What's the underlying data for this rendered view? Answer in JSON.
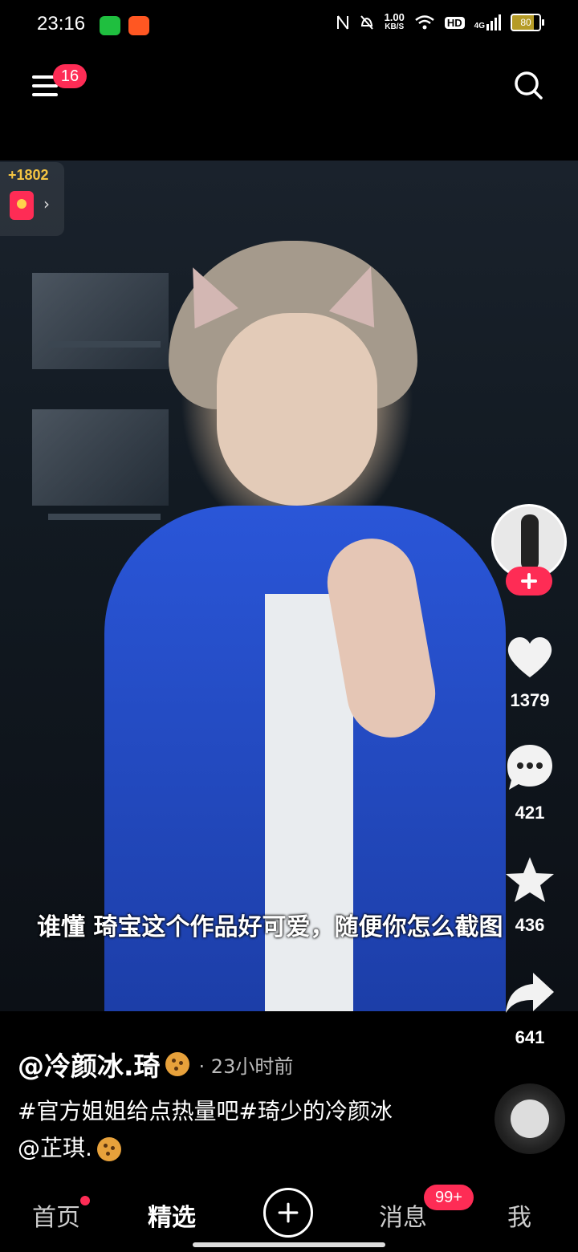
{
  "status_bar": {
    "time": "23:16",
    "network_speed": "1.00",
    "speed_unit": "KB/S",
    "hd": "HD",
    "signal_type": "4G",
    "battery": "80"
  },
  "top_nav": {
    "menu_badge": "16",
    "icons": [
      "menu-icon",
      "search-icon"
    ]
  },
  "reward": {
    "coins": "+1802",
    "chevron": "›"
  },
  "video": {
    "subtitle": "谁懂 琦宝这个作品好可爱，随便你怎么截图"
  },
  "actions": {
    "likes": "1379",
    "comments": "421",
    "favorites": "436",
    "shares": "641",
    "accent": "#fe2c55"
  },
  "post": {
    "author": "@冷颜冰.琦",
    "time_ago": "· 23小时前",
    "description": "#官方姐姐给点热量吧#琦少的冷颜冰@芷琪."
  },
  "bottom_nav": {
    "home": "首页",
    "featured": "精选",
    "messages": "消息",
    "messages_badge": "99+",
    "me": "我"
  }
}
